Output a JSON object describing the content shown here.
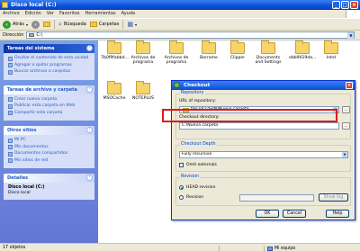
{
  "window": {
    "title": "Disco local (C:)"
  },
  "menu": [
    "Archivo",
    "Edición",
    "Ver",
    "Favoritos",
    "Herramientas",
    "Ayuda"
  ],
  "toolbar": {
    "back": "Atrás",
    "search": "Búsqueda",
    "folders": "Carpetas"
  },
  "address": {
    "label": "Dirección",
    "value": "C:\\"
  },
  "sidebar": {
    "system_tasks": {
      "title": "Tareas del sistema",
      "items": [
        "Ocultar el contenido de esta unidad",
        "Agregar o quitar programas",
        "Buscar archivos o carpetas"
      ]
    },
    "file_tasks": {
      "title": "Tareas de archivo y carpeta",
      "items": [
        "Crear nueva carpeta",
        "Publicar esta carpeta en Web",
        "Compartir esta carpeta"
      ]
    },
    "other_places": {
      "title": "Otros sitios",
      "items": [
        "Mi PC",
        "Mis documentos",
        "Documentos compartidos",
        "Mis sitios de red"
      ]
    },
    "details": {
      "title": "Detalles",
      "name": "Disco local (C:)",
      "type": "Disco local"
    }
  },
  "files": [
    {
      "name": "7b0f9fabbd..."
    },
    {
      "name": "Archivos de programa"
    },
    {
      "name": "Archivos de programa"
    },
    {
      "name": "Borrame"
    },
    {
      "name": "Clipper"
    },
    {
      "name": "Documents and Settings"
    },
    {
      "name": "ebb9019da..."
    },
    {
      "name": "Intel"
    },
    {
      "name": "MSOCache"
    },
    {
      "name": "NOTEPLUS"
    }
  ],
  "status": {
    "items": "17 objetos",
    "size": "",
    "location": "Mi equipo"
  },
  "dialog": {
    "title": "Checkout",
    "repository_label": "Repository",
    "url_label": "URL of repository:",
    "url_value": "file:///D:/SVN/Nueva carpeta",
    "dir_label": "Checkout directory:",
    "dir_value": "C:\\Nueva carpeta",
    "depth_label": "Checkout Depth",
    "depth_value": "Fully recursive",
    "omit_externals": "Omit externals",
    "revision_label": "Revision",
    "head_revision": "HEAD revision",
    "revision": "Revision",
    "show_log": "Show log",
    "ok": "OK",
    "cancel": "Cancel",
    "help": "Help"
  }
}
